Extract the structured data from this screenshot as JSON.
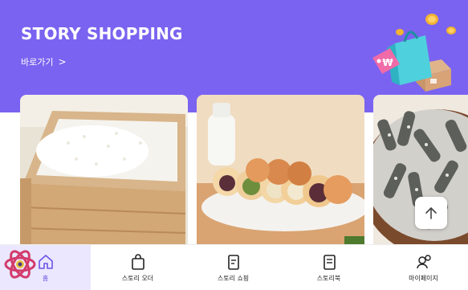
{
  "banner": {
    "title": "STORY SHOPPING",
    "link_label": "바로가기",
    "link_chevron": ">",
    "background": "#7a63f0",
    "illustration": "shopping-bag-coins-illustration",
    "bag_badge": "₩"
  },
  "products": [
    {
      "name": "rice-image"
    },
    {
      "name": "rice-cake-dessert-image"
    },
    {
      "name": "seaweed-snack-image"
    }
  ],
  "scroll_top": {
    "icon": "arrow-up-icon"
  },
  "tabs": [
    {
      "label": "홈",
      "icon": "home-icon",
      "active": true
    },
    {
      "label": "스토리 오더",
      "icon": "bag-icon",
      "active": false
    },
    {
      "label": "스토리 쇼핑",
      "icon": "receipt-icon",
      "active": false
    },
    {
      "label": "스토리북",
      "icon": "book-icon",
      "active": false
    },
    {
      "label": "마이페이지",
      "icon": "people-icon",
      "active": false
    }
  ],
  "colors": {
    "accent": "#7a63f0",
    "active_tab_bg": "#ebe7ff"
  }
}
